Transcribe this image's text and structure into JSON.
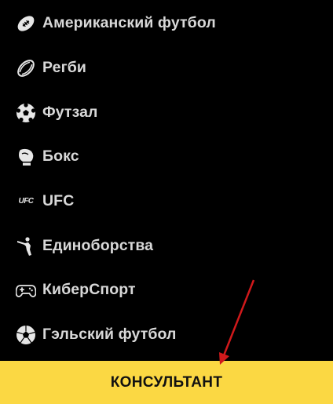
{
  "menu": {
    "items": [
      {
        "label": "Американский футбол",
        "icon": "american-football-icon"
      },
      {
        "label": "Регби",
        "icon": "rugby-ball-icon"
      },
      {
        "label": "Футзал",
        "icon": "futsal-ball-icon"
      },
      {
        "label": "Бокс",
        "icon": "boxing-glove-icon"
      },
      {
        "label": "UFC",
        "icon": "ufc-logo-icon"
      },
      {
        "label": "Единоборства",
        "icon": "martial-arts-icon"
      },
      {
        "label": "КиберСпорт",
        "icon": "gamepad-icon"
      },
      {
        "label": "Гэльский футбол",
        "icon": "gaelic-football-icon"
      }
    ]
  },
  "ufc_icon_text": "UFC",
  "consultant": {
    "label": "КОНСУЛЬТАНТ"
  },
  "colors": {
    "background": "#000000",
    "accent": "#fbd843",
    "label": "#d8d8d8",
    "arrow": "#d0191b"
  }
}
